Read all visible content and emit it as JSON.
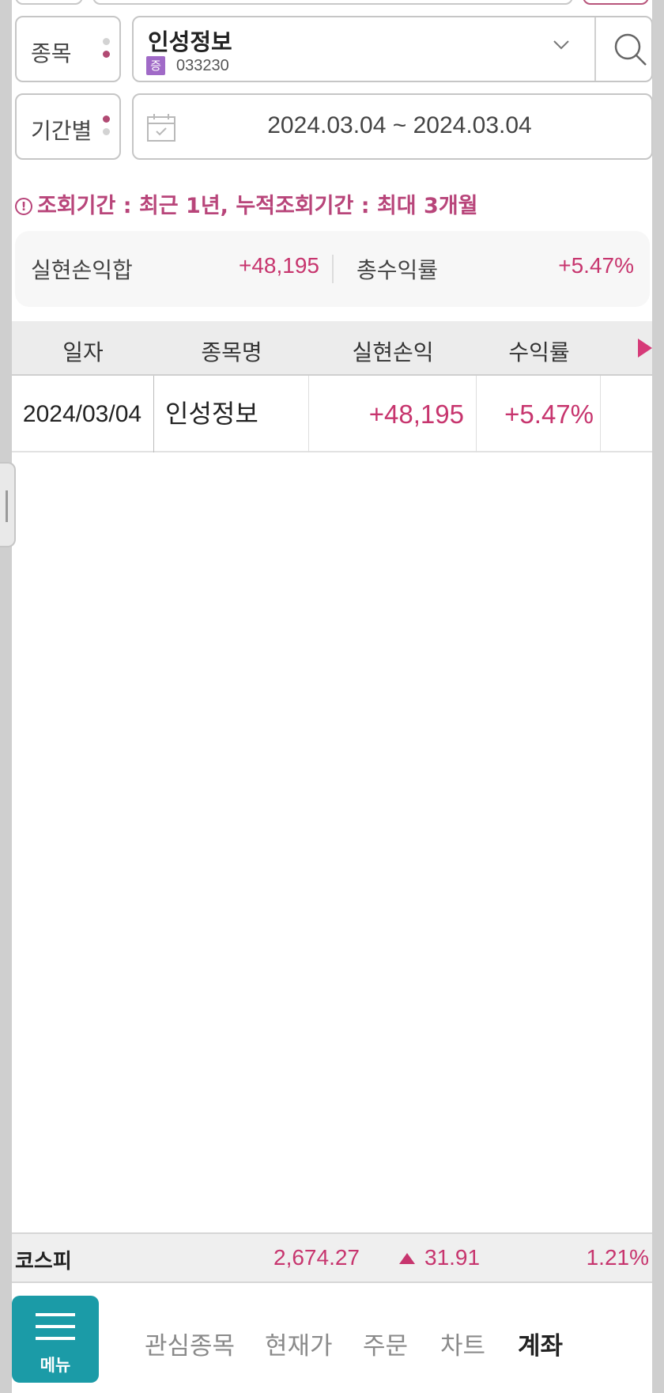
{
  "filters": {
    "stock_label": "종목",
    "stock_name": "인성정보",
    "stock_badge": "증",
    "stock_code": "033230",
    "period_label": "기간별",
    "date_range": "2024.03.04 ~ 2024.03.04"
  },
  "notice": {
    "icon": "!",
    "text": "조회기간 : 최근 1년, 누적조회기간 : 최대 3개월"
  },
  "summary": {
    "pnl_label": "실현손익합",
    "pnl_value": "+48,195",
    "return_label": "총수익률",
    "return_value": "+5.47%"
  },
  "table": {
    "headers": [
      "일자",
      "종목명",
      "실현손익",
      "수익률"
    ],
    "rows": [
      [
        "2024/03/04",
        "인성정보",
        "+48,195",
        "+5.47%"
      ]
    ]
  },
  "ticker": {
    "name": "코스피",
    "price": "2,674.27",
    "change": "31.91",
    "change_pct": "1.21%"
  },
  "nav": {
    "menu_label": "메뉴",
    "items": [
      "관심종목",
      "현재가",
      "주문",
      "차트",
      "계좌"
    ],
    "active": "계좌"
  },
  "colors": {
    "accent": "#c7356e",
    "menu": "#1b9ba7",
    "badge": "#a06ac7"
  },
  "icons": [
    "chevron-down-icon",
    "search-icon",
    "calendar-icon",
    "info-icon",
    "scroll-right-icon",
    "up-triangle-icon",
    "hamburger-icon"
  ]
}
